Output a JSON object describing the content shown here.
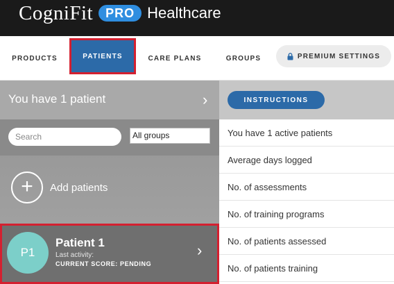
{
  "brand": {
    "logo_text": "CogniFit",
    "badge_text": "PRO",
    "product_name": "Healthcare"
  },
  "nav": {
    "products": "PRODUCTS",
    "patients": "PATIENTS",
    "care_plans": "CARE PLANS",
    "groups": "GROUPS",
    "premium": "PREMIUM SETTINGS"
  },
  "patients_panel": {
    "count_text": "You have 1 patient",
    "search_placeholder": "Search",
    "group_filter_value": "All groups",
    "add_label": "Add patients",
    "patient": {
      "initials": "P1",
      "name": "Patient 1",
      "activity": "Last activity:",
      "score": "CURRENT SCORE: PENDING"
    }
  },
  "stats_panel": {
    "instructions_label": "INSTRUCTIONS",
    "items": [
      "You have 1 active patients",
      "Average days logged",
      "No. of assessments",
      "No. of training programs",
      "No. of patients assessed",
      "No. of patients training"
    ]
  },
  "colors": {
    "header_bg": "#1a1a1a",
    "accent_blue": "#2c6aa8",
    "badge_blue": "#2f8ee0",
    "highlight_red": "#d42030",
    "avatar_teal": "#7ccfc9"
  }
}
